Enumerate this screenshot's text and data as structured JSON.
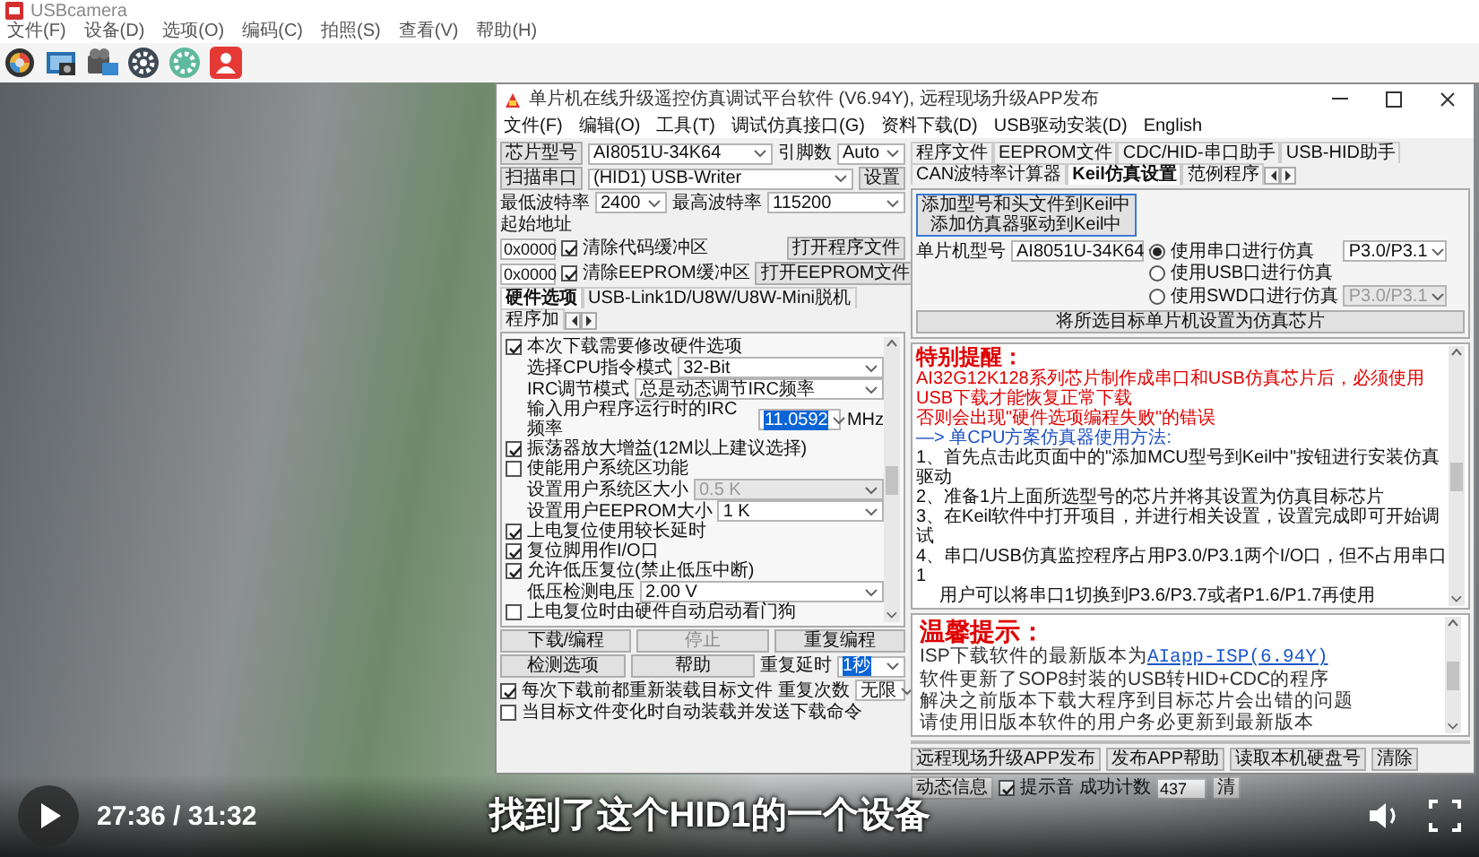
{
  "camera_window": {
    "title": "USBcamera",
    "menu": [
      "文件(F)",
      "设备(D)",
      "选项(O)",
      "编码(C)",
      "拍照(S)",
      "查看(V)",
      "帮助(H)"
    ]
  },
  "app_window": {
    "title": "单片机在线升级遥控仿真调试平台软件 (V6.94Y), 远程现场升级APP发布",
    "menu": [
      "文件(F)",
      "编辑(O)",
      "工具(T)",
      "调试仿真接口(G)",
      "资料下载(D)",
      "USB驱动安装(D)",
      "English"
    ],
    "left_panel": {
      "chip": {
        "button": "芯片型号",
        "value": "AI8051U-34K64",
        "pins_label": "引脚数",
        "pins": "Auto"
      },
      "port": {
        "button": "扫描串口",
        "value": "(HID1) USB-Writer",
        "settings_button": "设置"
      },
      "baud": {
        "min_label": "最低波特率",
        "min": "2400",
        "max_label": "最高波特率",
        "max": "115200"
      },
      "start_address_label": "起始地址",
      "address_rows": [
        {
          "address": "0x0000",
          "label": "清除代码缓冲区",
          "checked": true,
          "button": "打开程序文件"
        },
        {
          "address": "0x0000",
          "label": "清除EEPROM缓冲区",
          "checked": true,
          "button": "打开EEPROM文件"
        }
      ],
      "tabs": [
        {
          "label": "硬件选项",
          "selected": true
        },
        {
          "label": "USB-Link1D/U8W/U8W-Mini脱机",
          "selected": false
        },
        {
          "label": "程序加",
          "selected": false
        }
      ],
      "options": [
        {
          "kind": "checkbox",
          "label": "本次下载需要修改硬件选项",
          "checked": true
        },
        {
          "kind": "select",
          "label": "选择CPU指令模式",
          "value": "32-Bit",
          "disabled": false
        },
        {
          "kind": "select",
          "label": "IRC调节模式",
          "value": "总是动态调节IRC频率",
          "disabled": false
        },
        {
          "kind": "combo",
          "label": "输入用户程序运行时的IRC频率",
          "value": "11.0592",
          "text_selected": true,
          "unit": "MHz"
        },
        {
          "kind": "checkbox",
          "label": "振荡器放大增益(12M以上建议选择)",
          "checked": true
        },
        {
          "kind": "checkbox",
          "label": "使能用户系统区功能",
          "checked": false
        },
        {
          "kind": "select",
          "label": "设置用户系统区大小",
          "value": "0.5 K",
          "disabled": true
        },
        {
          "kind": "select",
          "label": "设置用户EEPROM大小",
          "value": "1 K",
          "disabled": false
        },
        {
          "kind": "checkbox",
          "label": "上电复位使用较长延时",
          "checked": true
        },
        {
          "kind": "checkbox",
          "label": "复位脚用作I/O口",
          "checked": true
        },
        {
          "kind": "checkbox",
          "label": "允许低压复位(禁止低压中断)",
          "checked": true
        },
        {
          "kind": "select",
          "label": "低压检测电压",
          "value": "2.00 V",
          "disabled": false
        },
        {
          "kind": "checkbox",
          "label": "上电复位时由硬件自动启动看门狗",
          "checked": false
        }
      ],
      "buttons": [
        {
          "label": "下载/编程",
          "disabled": false
        },
        {
          "label": "停止",
          "disabled": true
        },
        {
          "label": "重复编程",
          "disabled": false
        },
        {
          "label": "检测选项",
          "disabled": false
        },
        {
          "label": "帮助",
          "disabled": false
        }
      ],
      "repeat_delay": {
        "label": "重复延时",
        "value": "1秒",
        "text_selected": true
      },
      "repeat_count": {
        "label": "重复次数",
        "value": "无限",
        "text_selected": false
      },
      "bottom_checks": [
        {
          "label": "每次下载前都重新装载目标文件",
          "checked": true
        },
        {
          "label": "当目标文件变化时自动装载并发送下载命令",
          "checked": false
        }
      ]
    },
    "right_panel": {
      "tabs": [
        {
          "label": "程序文件",
          "selected": false
        },
        {
          "label": "EEPROM文件",
          "selected": false
        },
        {
          "label": "CDC/HID-串口助手",
          "selected": false
        },
        {
          "label": "USB-HID助手",
          "selected": false
        },
        {
          "label": "CAN波特率计算器",
          "selected": false
        },
        {
          "label": "Keil仿真设置",
          "selected": true
        },
        {
          "label": "范例程序",
          "selected": false
        }
      ],
      "add_button": [
        "添加型号和头文件到Keil中",
        "添加仿真器驱动到Keil中"
      ],
      "mcu_label": "单片机型号",
      "mcu": "AI8051U-34K64",
      "modes": [
        {
          "label": "使用串口进行仿真",
          "selected": true,
          "pins": "P3.0/P3.1",
          "pins_disabled": false
        },
        {
          "label": "使用USB口进行仿真",
          "selected": false
        },
        {
          "label": "使用SWD口进行仿真",
          "selected": false,
          "pins": "P3.0/P3.1",
          "pins_disabled": true
        }
      ],
      "set_button": "将所选目标单片机设置为仿真芯片",
      "notice": {
        "title": "特别提醒：",
        "warning": [
          "AI32G12K128系列芯片制作成串口和USB仿真芯片后，必须使用USB下载才能恢复正常下载",
          "否则会出现\"硬件选项编程失败\"的错误"
        ],
        "method_title": "—> 单CPU方案仿真器使用方法:",
        "steps": [
          "1、首先点击此页面中的\"添加MCU型号到Keil中\"按钮进行安装仿真驱动",
          "2、准备1片上面所选型号的芯片并将其设置为仿真目标芯片",
          "3、在Keil软件中打开项目，并进行相关设置，设置完成即可开始调试",
          "4、串口/USB仿真监控程序占用P3.0/P3.1两个I/O口，但不占用串口1",
          "　 用户可以将串口1切换到P3.6/P3.7或者P1.6/P1.7再使用"
        ]
      },
      "tips": {
        "title": "温馨提示：",
        "version_text": "ISP下载软件的最新版本为",
        "version_link": "AIapp-ISP(6.94Y)",
        "lines": [
          "软件更新了SOP8封装的USB转HID+CDC的程序",
          "解决之前版本下载大程序到目标芯片会出错的问题",
          "请使用旧版本软件的用户务必更新到最新版本"
        ]
      },
      "bottom_buttons": [
        "远程现场升级APP发布",
        "发布APP帮助",
        "读取本机硬盘号",
        "清除",
        "动态信息"
      ],
      "beep": {
        "label": "提示音",
        "checked": true
      },
      "count_label": "成功计数",
      "count": "437",
      "reset_button": "清"
    }
  },
  "video_player": {
    "playing": false,
    "time": "27:36 / 31:32",
    "subtitle": "找到了这个HID1的一个设备"
  }
}
